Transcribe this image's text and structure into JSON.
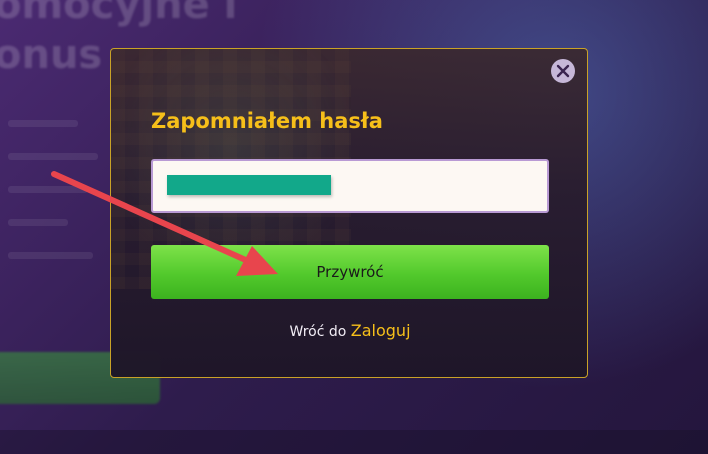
{
  "background": {
    "heading_lines": [
      "omocyjne i",
      "onus"
    ]
  },
  "modal": {
    "title": "Zapomniałem hasła",
    "email_value": "",
    "restore_label": "Przywróć",
    "back_text": "Wróć do",
    "login_link": "Zaloguj",
    "close_icon": "close-icon"
  },
  "colors": {
    "accent_gold": "#f6bf1a",
    "button_green": "#52c92c",
    "border_gold": "#c9a227",
    "annotation_arrow": "#e8454d",
    "redaction": "#12a88a"
  }
}
